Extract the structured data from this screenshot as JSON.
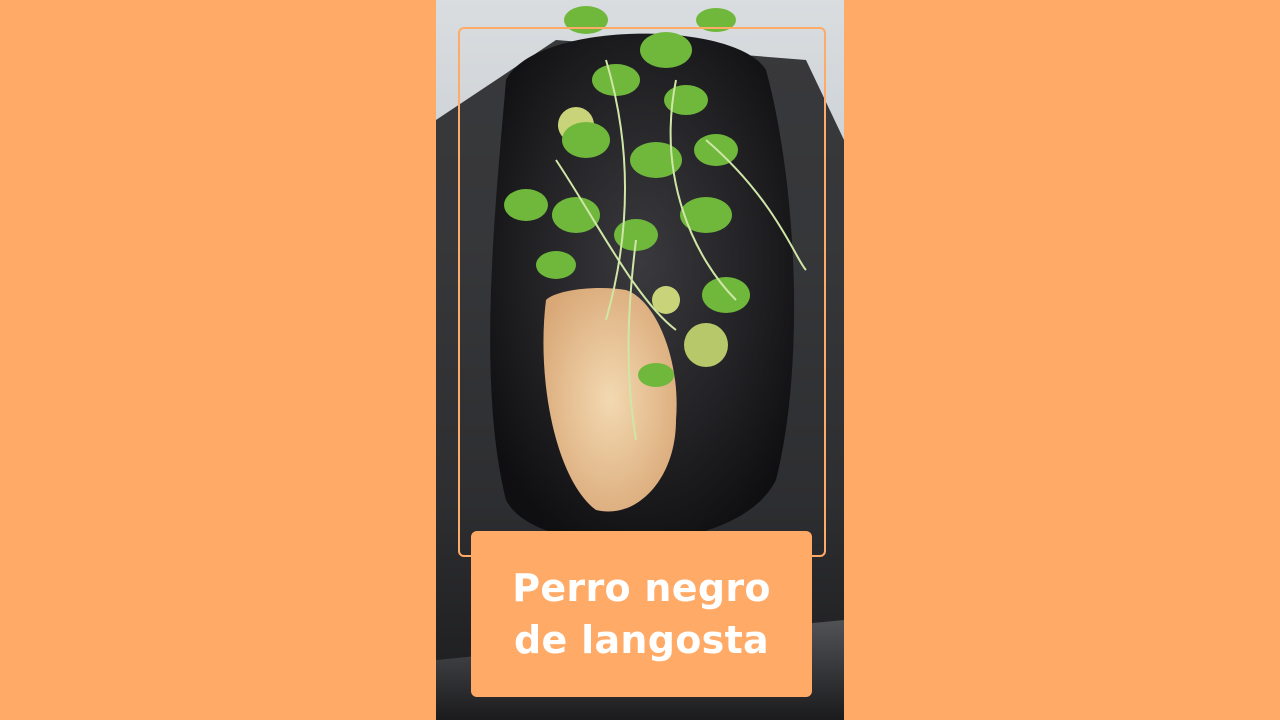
{
  "background_color": "#FFAA66",
  "photo": {
    "subject_icon": "lobster-hot-dog-photo"
  },
  "caption": {
    "line1": "Perro negro",
    "line2": "de langosta",
    "box_color": "#FFAA66",
    "text_color": "#FFFFFF"
  }
}
